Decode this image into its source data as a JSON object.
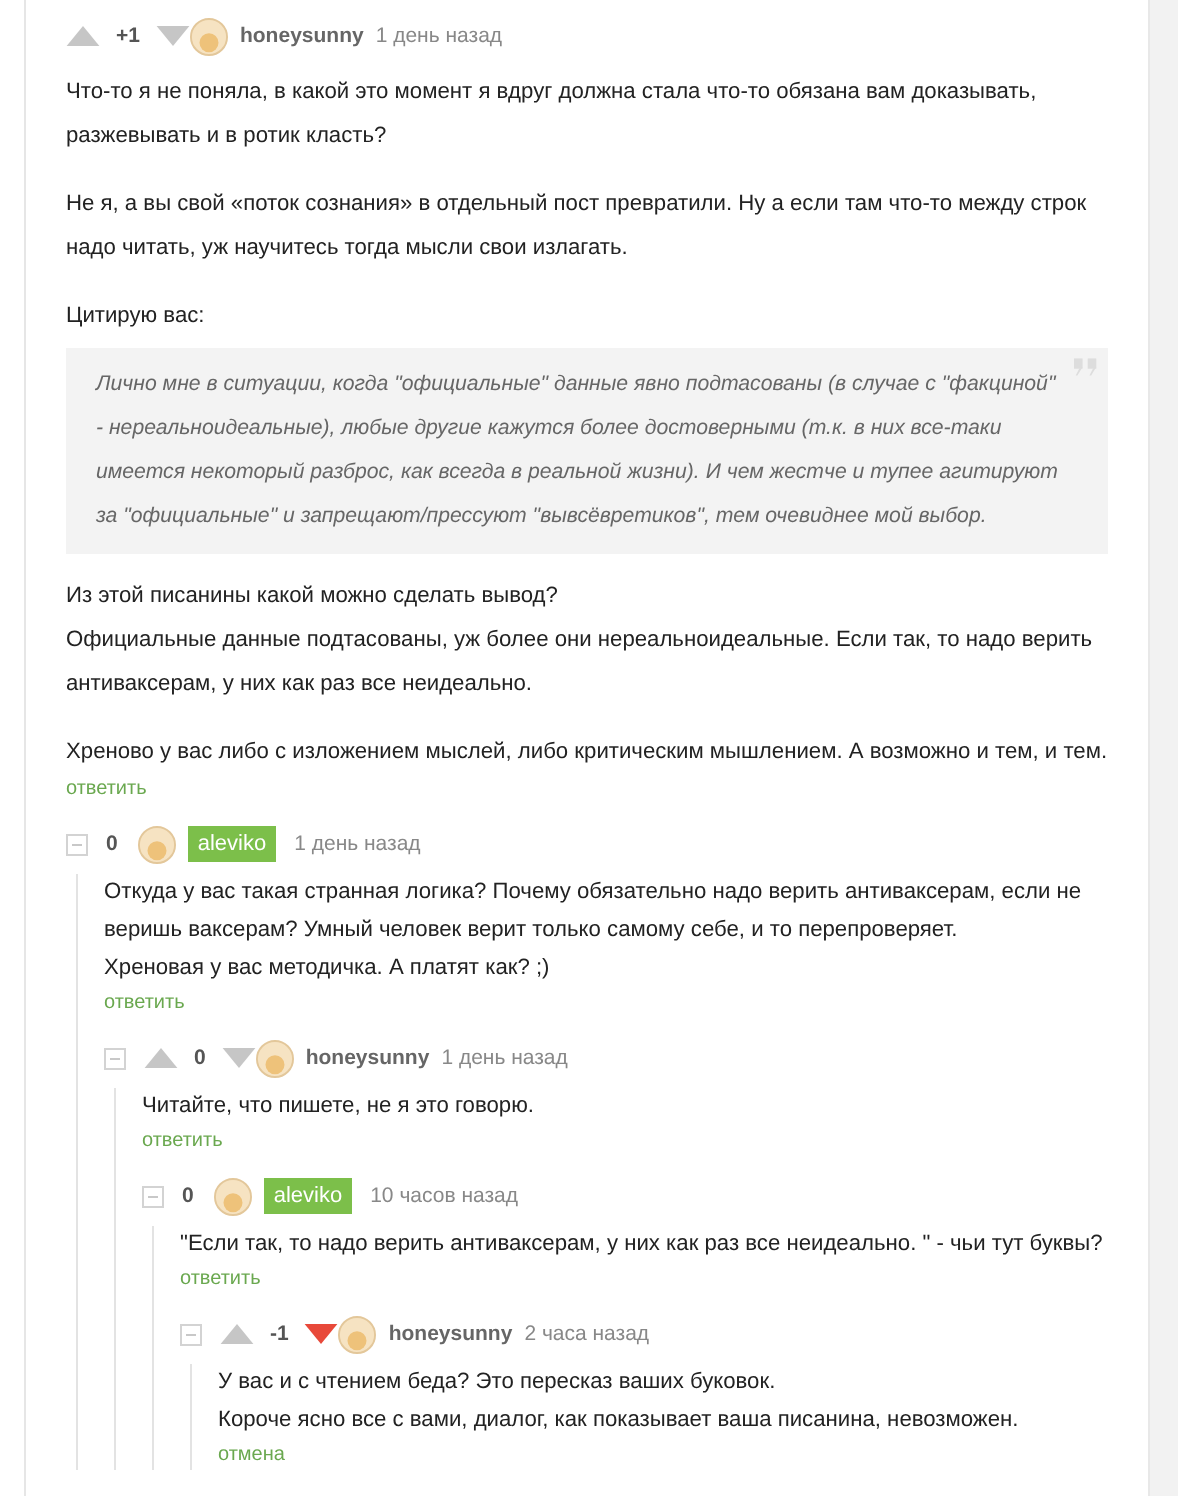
{
  "comments": [
    {
      "collapsible": false,
      "vote_arrows": true,
      "score": "+1",
      "downvoted": false,
      "author": "honeysunny",
      "author_highlighted": false,
      "time": "1 день назад",
      "body": [
        {
          "text": "Что-то я не поняла, в какой это момент я вдруг должна стала что-то обязана вам доказывать, разжевывать и в ротик класть?"
        },
        {
          "text": "Не я, а вы свой «поток сознания» в отдельный пост превратили. Ну а если там что-то между строк надо читать, уж научитесь тогда мысли свои излагать."
        },
        {
          "text": "Цитирую вас:"
        },
        {
          "quote": "Лично мне в ситуации, когда \"официальные\" данные явно подтасованы (в случае с \"факциной\" - нереальноидеальные), любые другие кажутся более достоверными (т.к. в них все-таки имеется некоторый разброс, как всегда в реальной жизни). И чем жестче и тупее агитируют за \"официальные\" и запрещают/прессуют \"вывсёвретиков\", тем очевиднее мой выбор."
        },
        {
          "lines": [
            "Из этой писанины какой можно сделать вывод?",
            "Официальные данные подтасованы, уж более они нереальноидеальные. Если так, то надо верить антиваксерам, у них как раз все неидеально."
          ]
        },
        {
          "text": "Хреново у вас либо с изложением мыслей, либо критическим мышлением. А возможно и тем, и тем."
        }
      ],
      "action": "ответить",
      "children": [
        {
          "collapsible": true,
          "vote_arrows": false,
          "score": "0",
          "author": "aleviko",
          "author_highlighted": true,
          "time": "1 день назад",
          "body": [
            {
              "lines": [
                "Откуда у вас такая странная логика? Почему обязательно надо верить антиваксерам, если не веришь ваксерам? Умный человек верит только самому себе, и то перепроверяет.",
                "Хреновая у вас методичка. А платят как? ;)"
              ]
            }
          ],
          "action": "ответить",
          "children": [
            {
              "collapsible": true,
              "vote_arrows": true,
              "score": "0",
              "downvoted": false,
              "author": "honeysunny",
              "author_highlighted": false,
              "time": "1 день назад",
              "body": [
                {
                  "text": "Читайте, что пишете, не я это говорю."
                }
              ],
              "action": "ответить",
              "children": [
                {
                  "collapsible": true,
                  "vote_arrows": false,
                  "score": "0",
                  "author": "aleviko",
                  "author_highlighted": true,
                  "time": "10 часов назад",
                  "body": [
                    {
                      "text": "\"Если так, то надо верить антиваксерам, у них как раз все неидеально. \" - чьи тут буквы?"
                    }
                  ],
                  "action": "ответить",
                  "children": [
                    {
                      "collapsible": true,
                      "vote_arrows": true,
                      "score": "-1",
                      "downvoted": true,
                      "author": "honeysunny",
                      "author_highlighted": false,
                      "time": "2 часа назад",
                      "body": [
                        {
                          "lines": [
                            "У вас и с чтением беда? Это пересказ ваших буковок.",
                            "Короче ясно все с вами, диалог, как показывает ваша писанина, невозможен."
                          ]
                        }
                      ],
                      "action": "отмена"
                    }
                  ]
                }
              ]
            }
          ]
        }
      ]
    }
  ]
}
